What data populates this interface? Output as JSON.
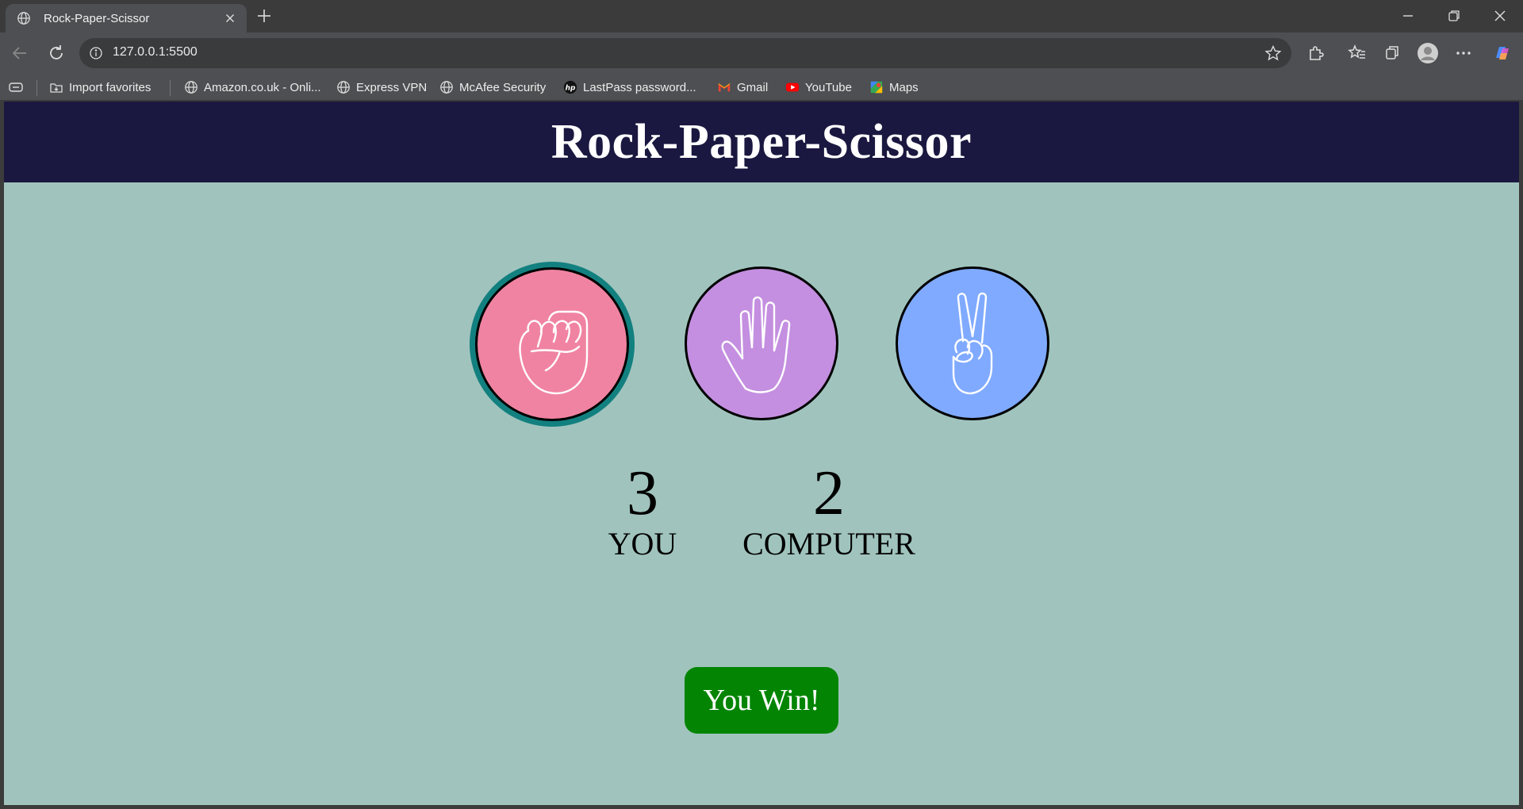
{
  "browser": {
    "tab": {
      "title": "Rock-Paper-Scissor"
    },
    "address_bar": {
      "url": "127.0.0.1:5500"
    },
    "bookmarks": [
      {
        "label": "Import favorites",
        "icon": "import-icon"
      },
      {
        "label": "Amazon.co.uk - Onli...",
        "icon": "globe-icon"
      },
      {
        "label": "Express VPN",
        "icon": "globe-icon"
      },
      {
        "label": "McAfee Security",
        "icon": "globe-icon"
      },
      {
        "label": "LastPass password...",
        "icon": "hp-icon"
      },
      {
        "label": "Gmail",
        "icon": "gmail-icon"
      },
      {
        "label": "YouTube",
        "icon": "youtube-icon"
      },
      {
        "label": "Maps",
        "icon": "maps-icon"
      }
    ]
  },
  "game": {
    "title": "Rock-Paper-Scissor",
    "choices": [
      {
        "id": "rock",
        "icon": "fist-icon",
        "color": "#f083a2",
        "selected": true
      },
      {
        "id": "paper",
        "icon": "open-hand-icon",
        "color": "#c48fe0",
        "selected": false
      },
      {
        "id": "scissors",
        "icon": "peace-hand-icon",
        "color": "#80aaff",
        "selected": false
      }
    ],
    "scores": {
      "user": {
        "value": "3",
        "label": "YOU"
      },
      "computer": {
        "value": "2",
        "label": "COMPUTER"
      }
    },
    "message": "You Win!",
    "colors": {
      "header_bg": "#1a1840",
      "page_bg": "#a0c4bd",
      "win_bg": "#038503",
      "selected_ring": "#138080"
    }
  }
}
